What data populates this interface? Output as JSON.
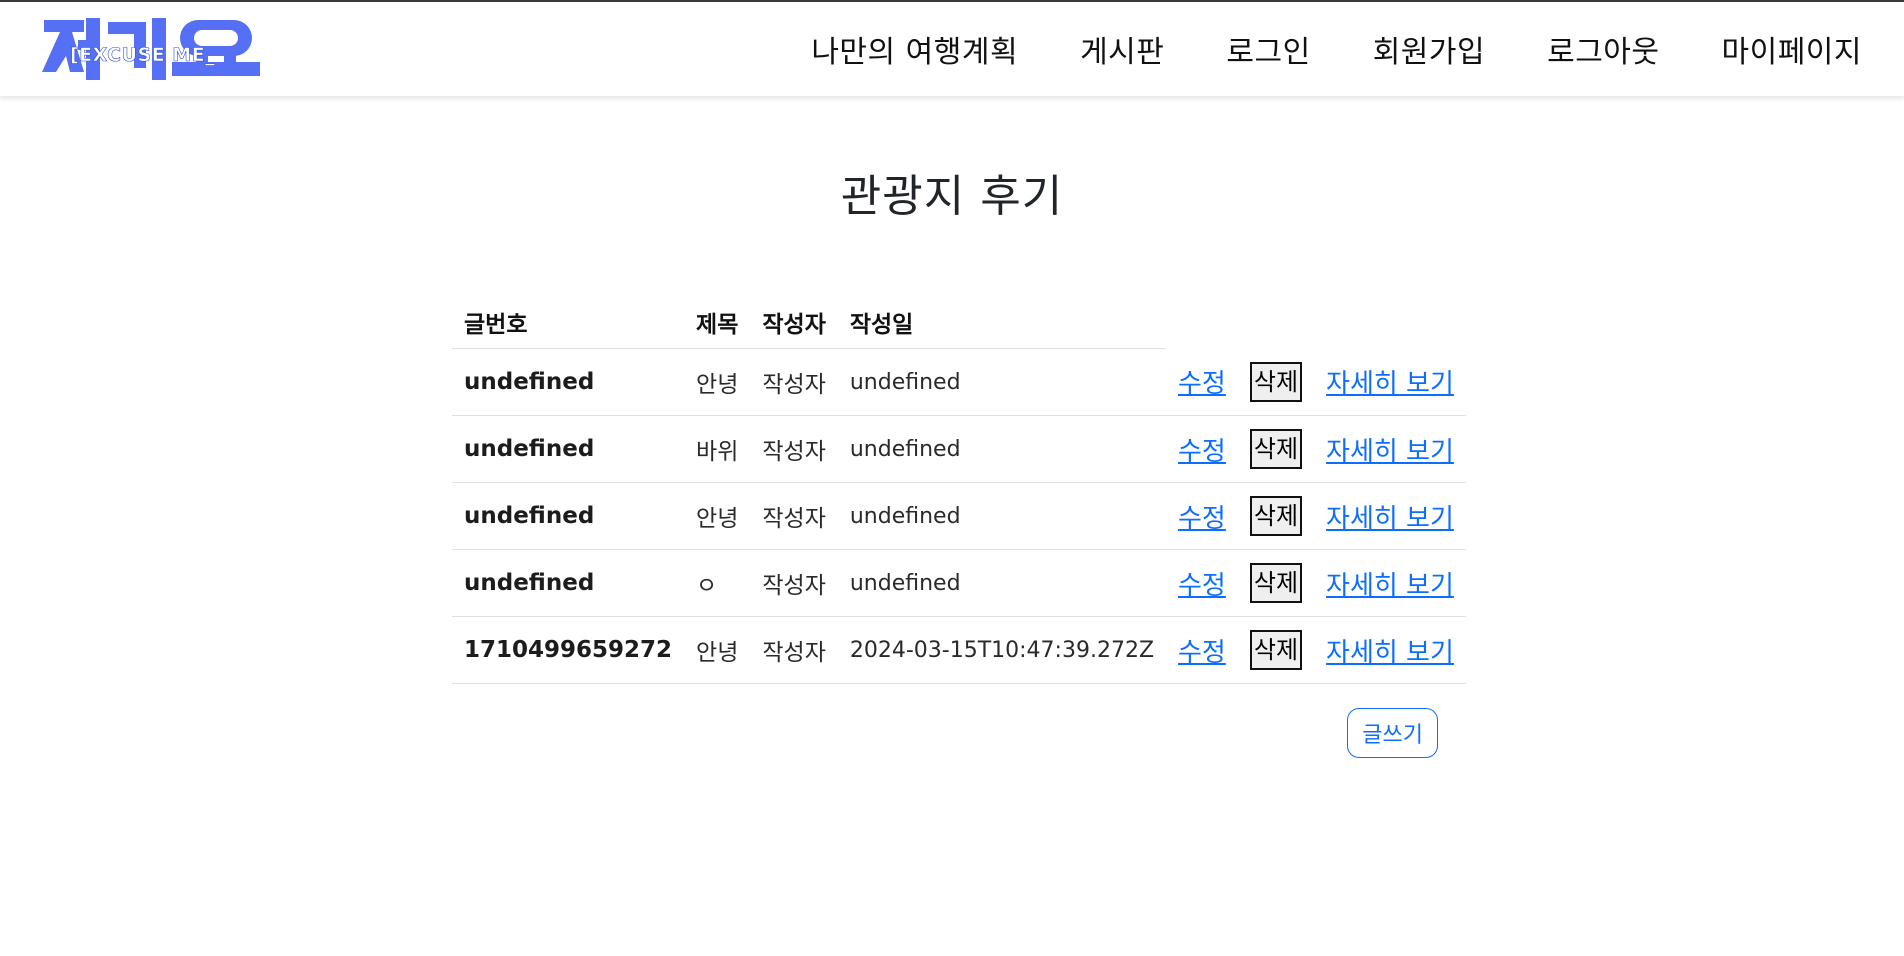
{
  "header": {
    "logo": {
      "korean_text": "저기요",
      "english_text": "EXCUSE ME",
      "color": "#5570f4"
    },
    "nav": [
      {
        "label": "나만의 여행계획"
      },
      {
        "label": "게시판"
      },
      {
        "label": "로그인"
      },
      {
        "label": "회원가입"
      },
      {
        "label": "로그아웃"
      },
      {
        "label": "마이페이지"
      }
    ]
  },
  "main": {
    "title": "관광지 후기",
    "table": {
      "headers": [
        "글번호",
        "제목",
        "작성자",
        "작성일"
      ],
      "edit_label": "수정",
      "delete_label": "삭제",
      "detail_label": "자세히 보기",
      "rows": [
        {
          "id": "undefined",
          "title": "안녕",
          "author": "작성자",
          "date": "undefined"
        },
        {
          "id": "undefined",
          "title": "바위",
          "author": "작성자",
          "date": "undefined"
        },
        {
          "id": "undefined",
          "title": "안녕",
          "author": "작성자",
          "date": "undefined"
        },
        {
          "id": "undefined",
          "title": "ㅇ",
          "author": "작성자",
          "date": "undefined"
        },
        {
          "id": "1710499659272",
          "title": "안녕",
          "author": "작성자",
          "date": "2024-03-15T10:47:39.272Z"
        }
      ]
    },
    "write_button": "글쓰기"
  },
  "colors": {
    "link": "#0d6efd",
    "logo": "#5570f4",
    "text": "#212529"
  }
}
